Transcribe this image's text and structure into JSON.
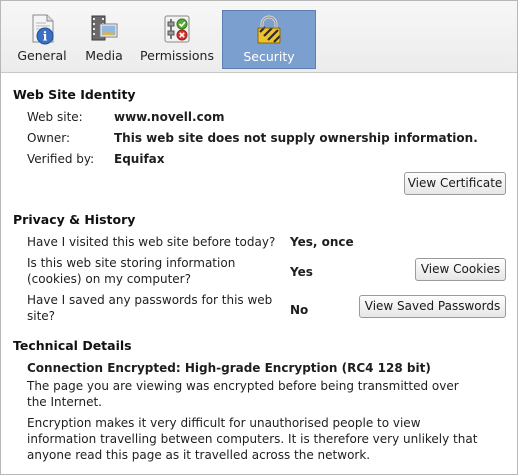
{
  "tabs": [
    {
      "label": "General",
      "icon": "info-page-icon"
    },
    {
      "label": "Media",
      "icon": "media-film-icon"
    },
    {
      "label": "Permissions",
      "icon": "permissions-toggle-icon"
    },
    {
      "label": "Security",
      "icon": "padlock-icon",
      "active": true
    }
  ],
  "identity": {
    "heading": "Web Site Identity",
    "website_label": "Web site:",
    "website_value": "www.novell.com",
    "owner_label": "Owner:",
    "owner_value": "This web site does not supply ownership information.",
    "verified_label": "Verified by:",
    "verified_value": "Equifax",
    "view_certificate": "View Certificate"
  },
  "privacy": {
    "heading": "Privacy & History",
    "q1": "Have I visited this web site before today?",
    "a1": "Yes, once",
    "q2_line1": "Is this web site storing information",
    "q2_line2": "(cookies) on my computer?",
    "a2": "Yes",
    "view_cookies": "View Cookies",
    "q3_line1": "Have I saved any passwords for this web",
    "q3_line2": "site?",
    "a3": "No",
    "view_passwords": "View Saved Passwords"
  },
  "technical": {
    "heading": "Technical Details",
    "connection": "Connection Encrypted: High-grade Encryption (RC4 128 bit)",
    "para1": "The page you are viewing was encrypted before being transmitted over the Internet.",
    "para2": "Encryption makes it very difficult for unauthorised people to view information travelling between computers. It is therefore very unlikely that anyone read this page as it travelled across the network."
  },
  "colors": {
    "active_tab": "#7b9fce",
    "active_tab_border": "#5c7eb0"
  }
}
